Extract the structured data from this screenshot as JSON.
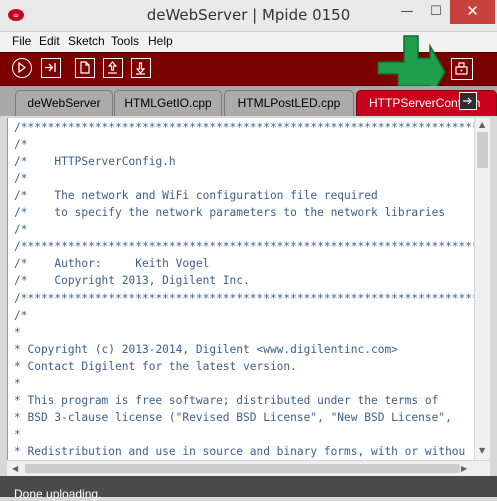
{
  "window": {
    "title": "deWebServer | Mpide 0150",
    "minimize_glyph": "—",
    "maximize_glyph": "☐",
    "close_glyph": "✕"
  },
  "menu": [
    "File",
    "Edit",
    "Sketch",
    "Tools",
    "Help"
  ],
  "toolbar": {
    "buttons": [
      "verify-icon",
      "upload-icon",
      "new-icon",
      "open-icon",
      "save-icon"
    ],
    "right_button": "serial-monitor-icon",
    "annotation": "green-arrow-pointing-down-right"
  },
  "tabs": [
    "deWebServer",
    "HTMLGetIO.cpp",
    "HTMLPostLED.cpp",
    "HTTPServerConfig.h"
  ],
  "active_tab_index": 3,
  "editor": {
    "lines": [
      "/************************************************************************/",
      "/*",
      "/*    HTTPServerConfig.h",
      "/*",
      "/*    The network and WiFi configuration file required",
      "/*    to specify the network parameters to the network libraries",
      "/*",
      "/************************************************************************/",
      "/*    Author:     Keith Vogel",
      "/*    Copyright 2013, Digilent Inc.",
      "/************************************************************************/",
      "/*",
      "*",
      "* Copyright (c) 2013-2014, Digilent <www.digilentinc.com>",
      "* Contact Digilent for the latest version.",
      "*",
      "* This program is free software; distributed under the terms of",
      "* BSD 3-clause license (\"Revised BSD License\", \"New BSD License\",",
      "*",
      "* Redistribution and use in source and binary forms, with or withou"
    ]
  },
  "status": {
    "message": "Done uploading."
  },
  "colors": {
    "toolbar_bg": "#7c0000",
    "active_tab": "#c8001e",
    "code_text": "#3d5f8a",
    "annotation_green": "#1f9e4e"
  }
}
